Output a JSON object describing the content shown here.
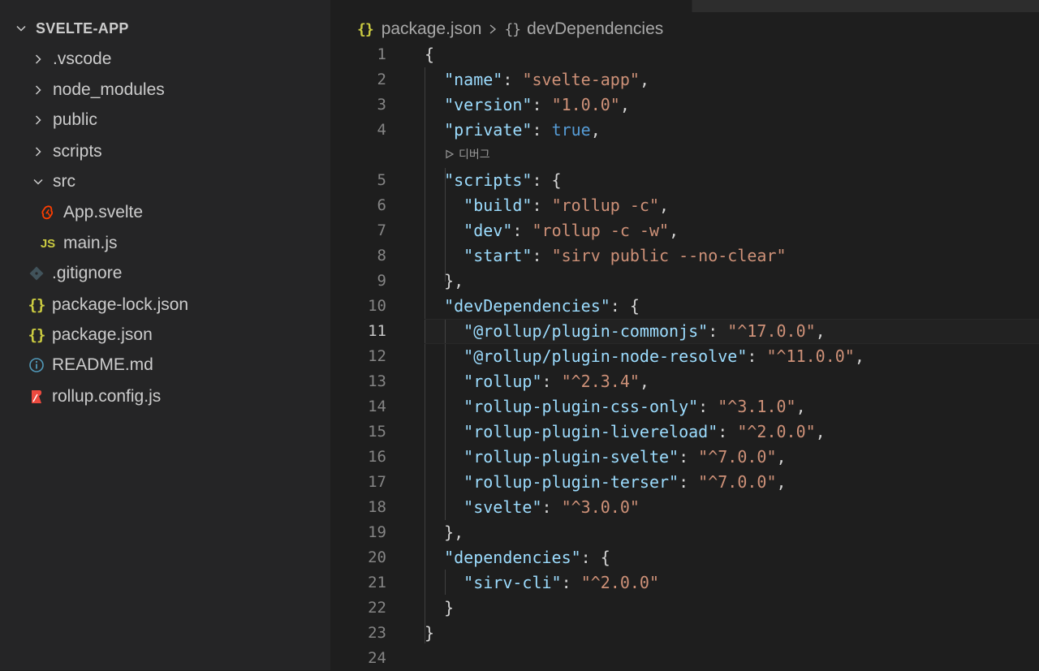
{
  "explorer": {
    "root_label": "SVELTE-APP",
    "items": [
      {
        "label": ".vscode",
        "type": "folder",
        "expanded": false,
        "icon": "chevron-right-icon"
      },
      {
        "label": "node_modules",
        "type": "folder",
        "expanded": false,
        "icon": "chevron-right-icon"
      },
      {
        "label": "public",
        "type": "folder",
        "expanded": false,
        "icon": "chevron-right-icon"
      },
      {
        "label": "scripts",
        "type": "folder",
        "expanded": false,
        "icon": "chevron-right-icon"
      },
      {
        "label": "src",
        "type": "folder",
        "expanded": true,
        "icon": "chevron-down-icon"
      },
      {
        "label": "App.svelte",
        "type": "file",
        "icon": "svelte-icon"
      },
      {
        "label": "main.js",
        "type": "file",
        "icon": "js-icon",
        "icon_text": "JS"
      },
      {
        "label": ".gitignore",
        "type": "file",
        "icon": "git-icon"
      },
      {
        "label": "package-lock.json",
        "type": "file",
        "icon": "json-icon",
        "icon_text": "{}"
      },
      {
        "label": "package.json",
        "type": "file",
        "icon": "json-icon",
        "icon_text": "{}"
      },
      {
        "label": "README.md",
        "type": "file",
        "icon": "info-icon"
      },
      {
        "label": "rollup.config.js",
        "type": "file",
        "icon": "rollup-icon"
      }
    ]
  },
  "breadcrumb": {
    "file_icon_text": "{}",
    "file": "package.json",
    "symbol_icon_text": "{}",
    "symbol": "devDependencies"
  },
  "codelens": {
    "label": "디버그",
    "icon": "play-outline-icon"
  },
  "editor": {
    "active_line": 11,
    "lines": [
      {
        "n": "1",
        "tokens": [
          [
            "p",
            "{"
          ]
        ]
      },
      {
        "n": "2",
        "tokens": [
          [
            "p",
            "  "
          ],
          [
            "k",
            "\"name\""
          ],
          [
            "p",
            ": "
          ],
          [
            "s",
            "\"svelte-app\""
          ],
          [
            "p",
            ","
          ]
        ]
      },
      {
        "n": "3",
        "tokens": [
          [
            "p",
            "  "
          ],
          [
            "k",
            "\"version\""
          ],
          [
            "p",
            ": "
          ],
          [
            "s",
            "\"1.0.0\""
          ],
          [
            "p",
            ","
          ]
        ]
      },
      {
        "n": "4",
        "tokens": [
          [
            "p",
            "  "
          ],
          [
            "k",
            "\"private\""
          ],
          [
            "p",
            ": "
          ],
          [
            "b",
            "true"
          ],
          [
            "p",
            ","
          ]
        ]
      },
      {
        "n": "5",
        "tokens": [
          [
            "p",
            "  "
          ],
          [
            "k",
            "\"scripts\""
          ],
          [
            "p",
            ": {"
          ]
        ]
      },
      {
        "n": "6",
        "tokens": [
          [
            "p",
            "    "
          ],
          [
            "k",
            "\"build\""
          ],
          [
            "p",
            ": "
          ],
          [
            "s",
            "\"rollup -c\""
          ],
          [
            "p",
            ","
          ]
        ]
      },
      {
        "n": "7",
        "tokens": [
          [
            "p",
            "    "
          ],
          [
            "k",
            "\"dev\""
          ],
          [
            "p",
            ": "
          ],
          [
            "s",
            "\"rollup -c -w\""
          ],
          [
            "p",
            ","
          ]
        ]
      },
      {
        "n": "8",
        "tokens": [
          [
            "p",
            "    "
          ],
          [
            "k",
            "\"start\""
          ],
          [
            "p",
            ": "
          ],
          [
            "s",
            "\"sirv public --no-clear\""
          ]
        ]
      },
      {
        "n": "9",
        "tokens": [
          [
            "p",
            "  },"
          ]
        ]
      },
      {
        "n": "10",
        "tokens": [
          [
            "p",
            "  "
          ],
          [
            "k",
            "\"devDependencies\""
          ],
          [
            "p",
            ": {"
          ]
        ]
      },
      {
        "n": "11",
        "tokens": [
          [
            "p",
            "    "
          ],
          [
            "k",
            "\"@rollup/plugin-commonjs\""
          ],
          [
            "p",
            ": "
          ],
          [
            "s",
            "\"^17.0.0\""
          ],
          [
            "p",
            ","
          ]
        ]
      },
      {
        "n": "12",
        "tokens": [
          [
            "p",
            "    "
          ],
          [
            "k",
            "\"@rollup/plugin-node-resolve\""
          ],
          [
            "p",
            ": "
          ],
          [
            "s",
            "\"^11.0.0\""
          ],
          [
            "p",
            ","
          ]
        ]
      },
      {
        "n": "13",
        "tokens": [
          [
            "p",
            "    "
          ],
          [
            "k",
            "\"rollup\""
          ],
          [
            "p",
            ": "
          ],
          [
            "s",
            "\"^2.3.4\""
          ],
          [
            "p",
            ","
          ]
        ]
      },
      {
        "n": "14",
        "tokens": [
          [
            "p",
            "    "
          ],
          [
            "k",
            "\"rollup-plugin-css-only\""
          ],
          [
            "p",
            ": "
          ],
          [
            "s",
            "\"^3.1.0\""
          ],
          [
            "p",
            ","
          ]
        ]
      },
      {
        "n": "15",
        "tokens": [
          [
            "p",
            "    "
          ],
          [
            "k",
            "\"rollup-plugin-livereload\""
          ],
          [
            "p",
            ": "
          ],
          [
            "s",
            "\"^2.0.0\""
          ],
          [
            "p",
            ","
          ]
        ]
      },
      {
        "n": "16",
        "tokens": [
          [
            "p",
            "    "
          ],
          [
            "k",
            "\"rollup-plugin-svelte\""
          ],
          [
            "p",
            ": "
          ],
          [
            "s",
            "\"^7.0.0\""
          ],
          [
            "p",
            ","
          ]
        ]
      },
      {
        "n": "17",
        "tokens": [
          [
            "p",
            "    "
          ],
          [
            "k",
            "\"rollup-plugin-terser\""
          ],
          [
            "p",
            ": "
          ],
          [
            "s",
            "\"^7.0.0\""
          ],
          [
            "p",
            ","
          ]
        ]
      },
      {
        "n": "18",
        "tokens": [
          [
            "p",
            "    "
          ],
          [
            "k",
            "\"svelte\""
          ],
          [
            "p",
            ": "
          ],
          [
            "s",
            "\"^3.0.0\""
          ]
        ]
      },
      {
        "n": "19",
        "tokens": [
          [
            "p",
            "  },"
          ]
        ]
      },
      {
        "n": "20",
        "tokens": [
          [
            "p",
            "  "
          ],
          [
            "k",
            "\"dependencies\""
          ],
          [
            "p",
            ": {"
          ]
        ]
      },
      {
        "n": "21",
        "tokens": [
          [
            "p",
            "    "
          ],
          [
            "k",
            "\"sirv-cli\""
          ],
          [
            "p",
            ": "
          ],
          [
            "s",
            "\"^2.0.0\""
          ]
        ]
      },
      {
        "n": "22",
        "tokens": [
          [
            "p",
            "  }"
          ]
        ]
      },
      {
        "n": "23",
        "tokens": [
          [
            "p",
            "}"
          ]
        ]
      },
      {
        "n": "24",
        "tokens": []
      }
    ]
  },
  "colors": {
    "sidebar_bg": "#252526",
    "editor_bg": "#1e1e1e",
    "json_key": "#9cdcfe",
    "json_string": "#ce9178",
    "json_boolean": "#569cd6",
    "json_icon": "#cbcb41",
    "svelte_icon": "#ff3e00",
    "rollup_icon": "#ec4a3f",
    "info_icon": "#519aba",
    "git_icon": "#41535b"
  }
}
